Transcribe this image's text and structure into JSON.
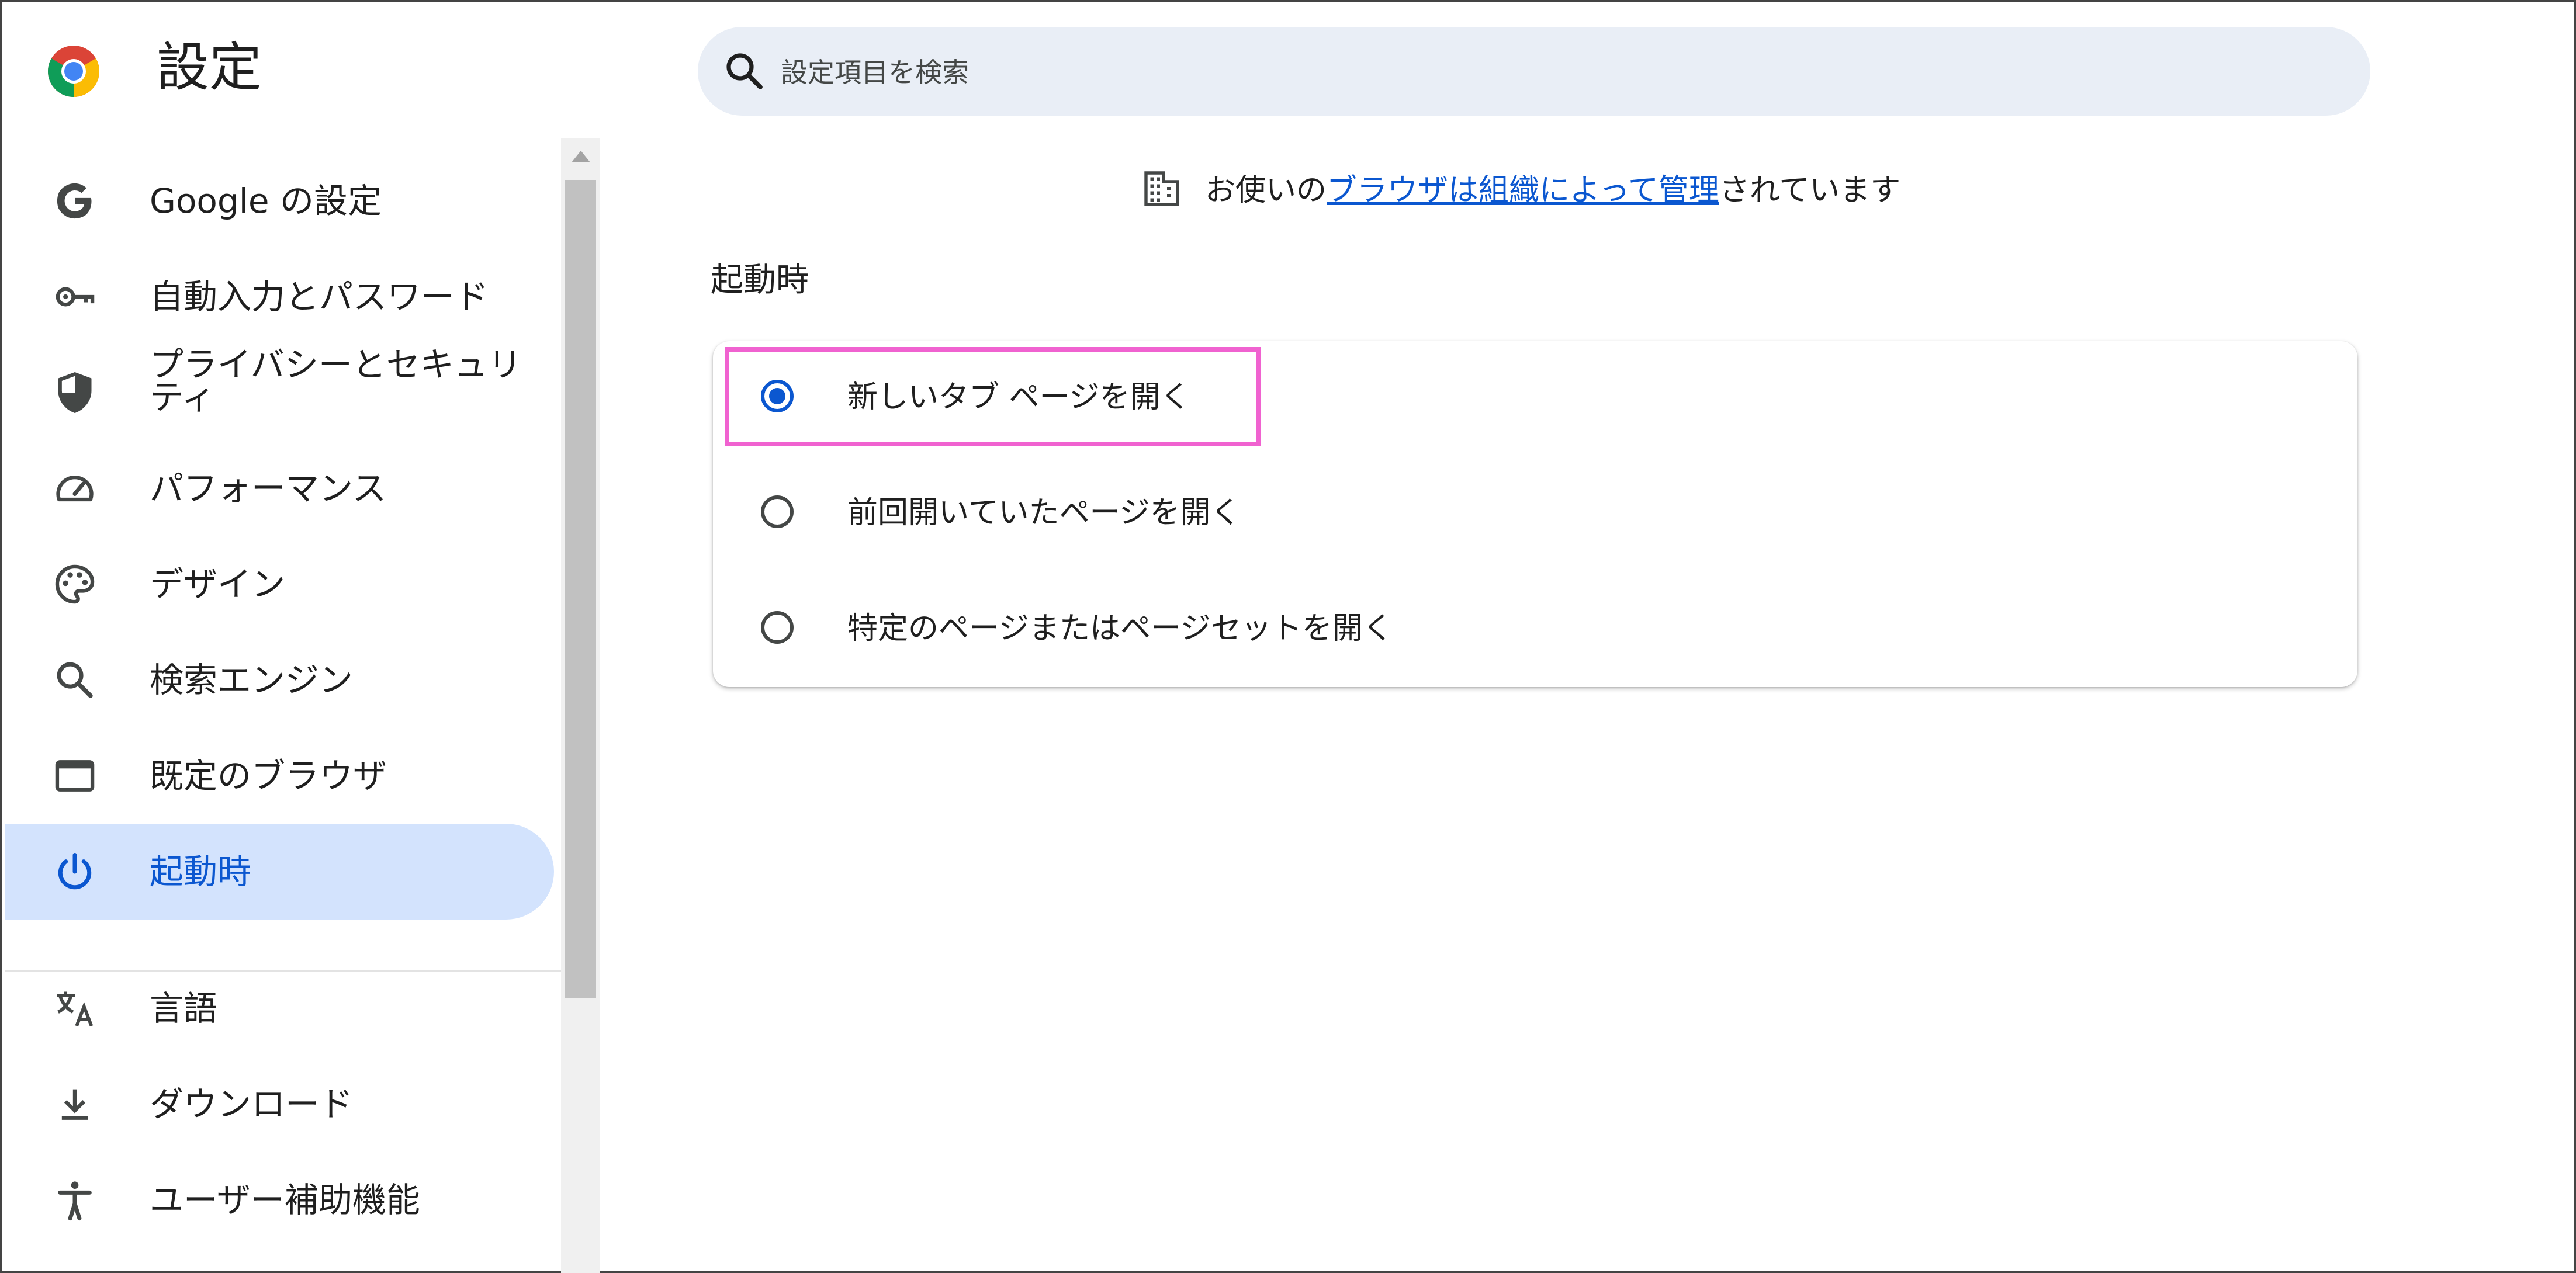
{
  "header": {
    "title": "設定",
    "logo_icon": "chrome-logo-icon",
    "search": {
      "placeholder": "設定項目を検索",
      "value": "",
      "icon": "search-icon"
    }
  },
  "sidebar": {
    "items": [
      {
        "label": "Google の設定",
        "icon": "google-g-icon",
        "active": false
      },
      {
        "label": "自動入力とパスワード",
        "icon": "key-icon",
        "active": false
      },
      {
        "label": "プライバシーとセキュリティ",
        "icon": "shield-icon",
        "active": false
      },
      {
        "label": "パフォーマンス",
        "icon": "speedometer-icon",
        "active": false
      },
      {
        "label": "デザイン",
        "icon": "palette-icon",
        "active": false
      },
      {
        "label": "検索エンジン",
        "icon": "search-icon",
        "active": false
      },
      {
        "label": "既定のブラウザ",
        "icon": "browser-window-icon",
        "active": false
      },
      {
        "label": "起動時",
        "icon": "power-icon",
        "active": true
      },
      {
        "label": "言語",
        "icon": "translate-icon",
        "active": false
      },
      {
        "label": "ダウンロード",
        "icon": "download-icon",
        "active": false
      },
      {
        "label": "ユーザー補助機能",
        "icon": "accessibility-icon",
        "active": false
      }
    ]
  },
  "main": {
    "managed_notice": {
      "icon": "building-icon",
      "prefix": "お使いの",
      "link": "ブラウザは組織によって管理",
      "suffix": "されています"
    },
    "section_heading": "起動時",
    "startup_options": [
      {
        "label": "新しいタブ ページを開く",
        "checked": true
      },
      {
        "label": "前回開いていたページを開く",
        "checked": false
      },
      {
        "label": "特定のページまたはページセットを開く",
        "checked": false
      }
    ],
    "highlighted_option": 0
  },
  "colors": {
    "accent": "#0b57d0",
    "active_nav_bg": "#d3e3fd",
    "search_bg": "#e9eef6",
    "highlight_border": "#f062d0"
  }
}
